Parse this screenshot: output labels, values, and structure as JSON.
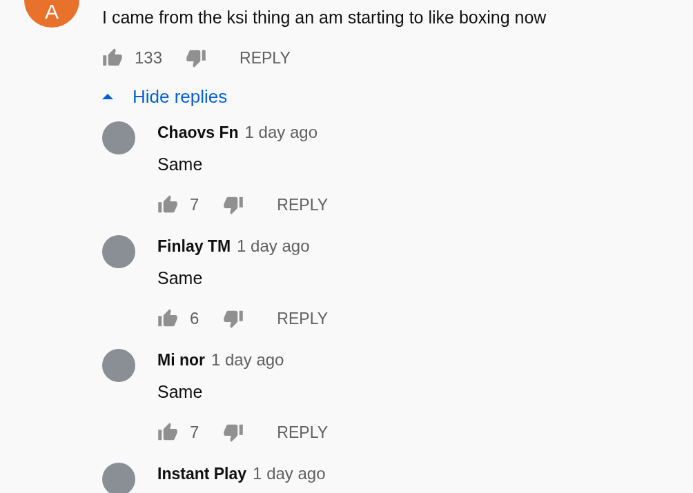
{
  "comment": {
    "avatar_letter": "A",
    "text": "I came from the ksi thing an am starting to like boxing now",
    "likes": "133",
    "reply_label": "REPLY"
  },
  "toggle": {
    "label": "Hide replies",
    "expanded": true
  },
  "replies": [
    {
      "author": "Chaovs Fn",
      "time": "1 day ago",
      "text": "Same",
      "likes": "7",
      "reply_label": "REPLY"
    },
    {
      "author": "Finlay TM",
      "time": "1 day ago",
      "text": "Same",
      "likes": "6",
      "reply_label": "REPLY"
    },
    {
      "author": "Mi nor",
      "time": "1 day ago",
      "text": "Same",
      "likes": "7",
      "reply_label": "REPLY"
    },
    {
      "author": "Instant Play",
      "time": "1 day ago"
    }
  ]
}
